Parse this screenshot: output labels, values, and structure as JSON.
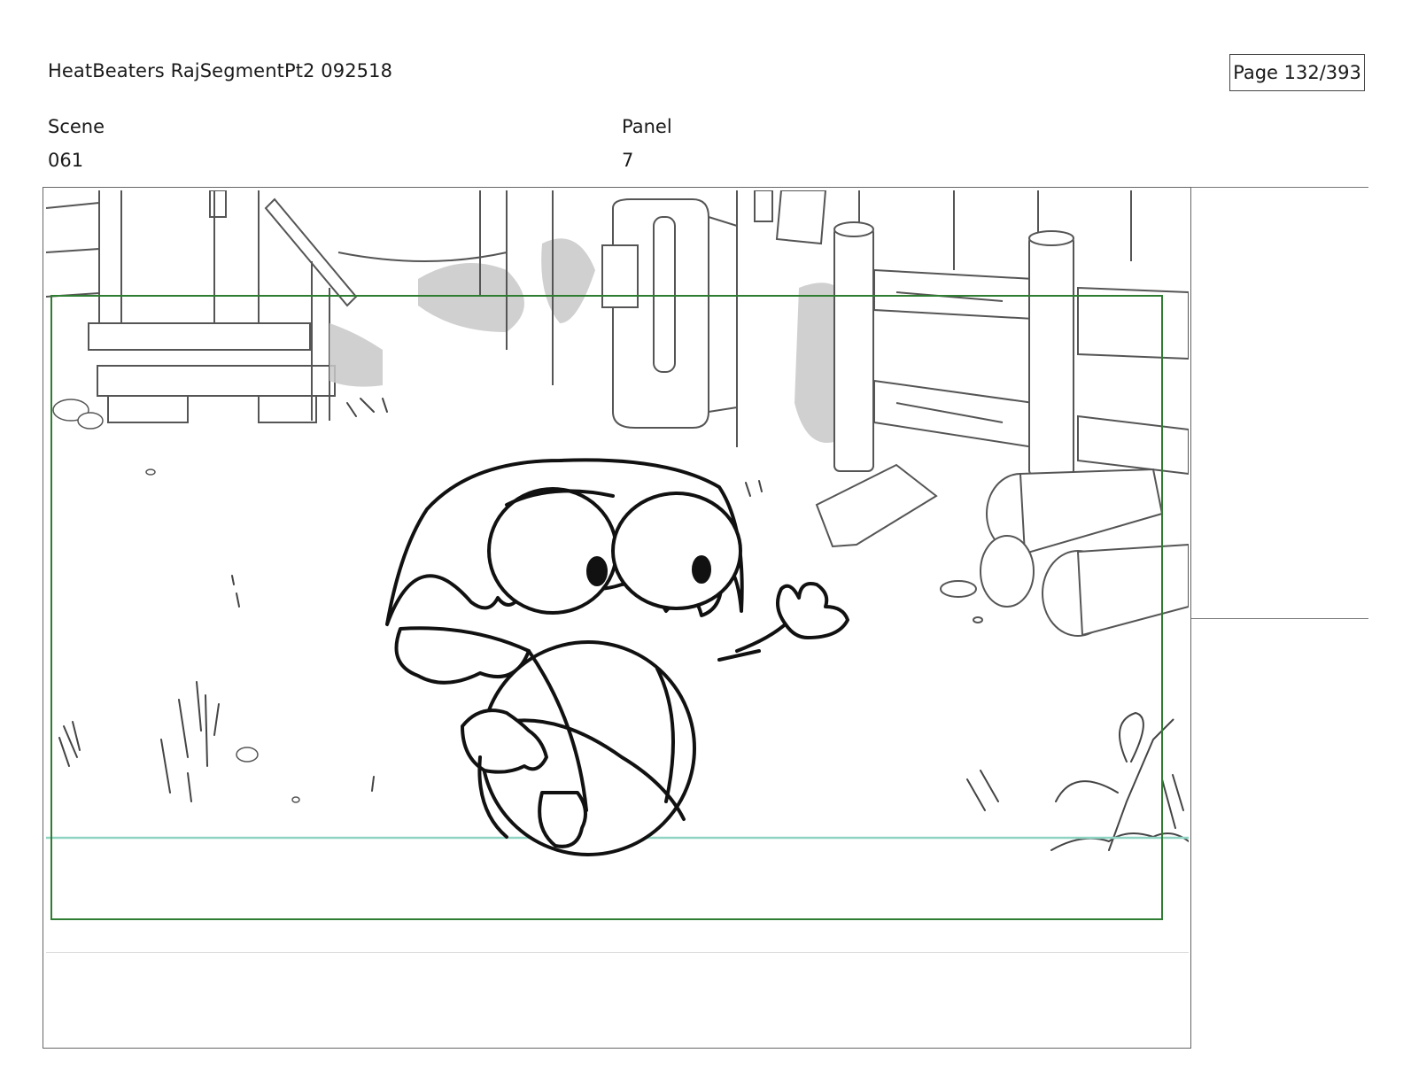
{
  "header": {
    "title": "HeatBeaters RajSegmentPt2 092518",
    "page": "Page 132/393"
  },
  "fields": {
    "scene_label": "Scene",
    "scene_value": "061",
    "panel_label": "Panel",
    "panel_value": "7"
  },
  "colors": {
    "safe_frame": "#2e7d32",
    "horizon_line": "#8fd3c3",
    "shadow_fill": "#c8c8c8"
  }
}
